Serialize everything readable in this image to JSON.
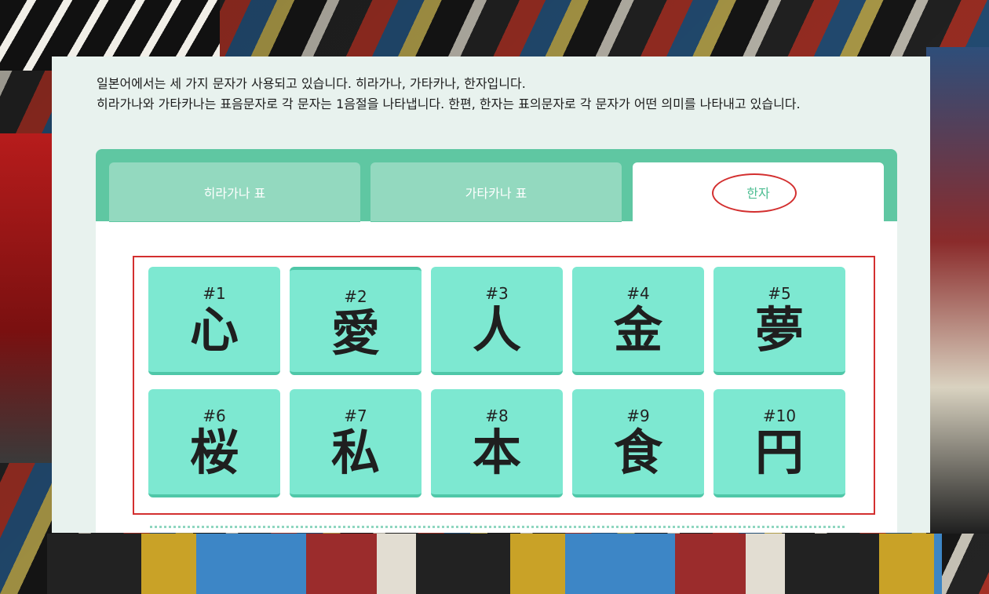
{
  "intro": {
    "line1": "일본어에서는 세 가지 문자가 사용되고 있습니다. 히라가나, 가타카나, 한자입니다.",
    "line2": "히라가나와 가타카나는 표음문자로 각 문자는 1음절을 나타냅니다. 한편, 한자는 표의문자로 각 문자가 어떤 의미를 나타내고 있습니다."
  },
  "tabs": [
    {
      "label": "히라가나 표",
      "active": false
    },
    {
      "label": "가타카나 표",
      "active": false
    },
    {
      "label": "한자",
      "active": true
    }
  ],
  "cards": [
    {
      "num": "#1",
      "kanji": "心"
    },
    {
      "num": "#2",
      "kanji": "愛"
    },
    {
      "num": "#3",
      "kanji": "人"
    },
    {
      "num": "#4",
      "kanji": "金"
    },
    {
      "num": "#5",
      "kanji": "夢"
    },
    {
      "num": "#6",
      "kanji": "桜"
    },
    {
      "num": "#7",
      "kanji": "私"
    },
    {
      "num": "#8",
      "kanji": "本"
    },
    {
      "num": "#9",
      "kanji": "食"
    },
    {
      "num": "#10",
      "kanji": "円"
    }
  ],
  "colors": {
    "tab_bar": "#5fc7a2",
    "tab_inactive": "#93d9bf",
    "active_tab_text": "#4dbd92",
    "card": "#7de8d1",
    "highlight": "#d32f2f"
  }
}
